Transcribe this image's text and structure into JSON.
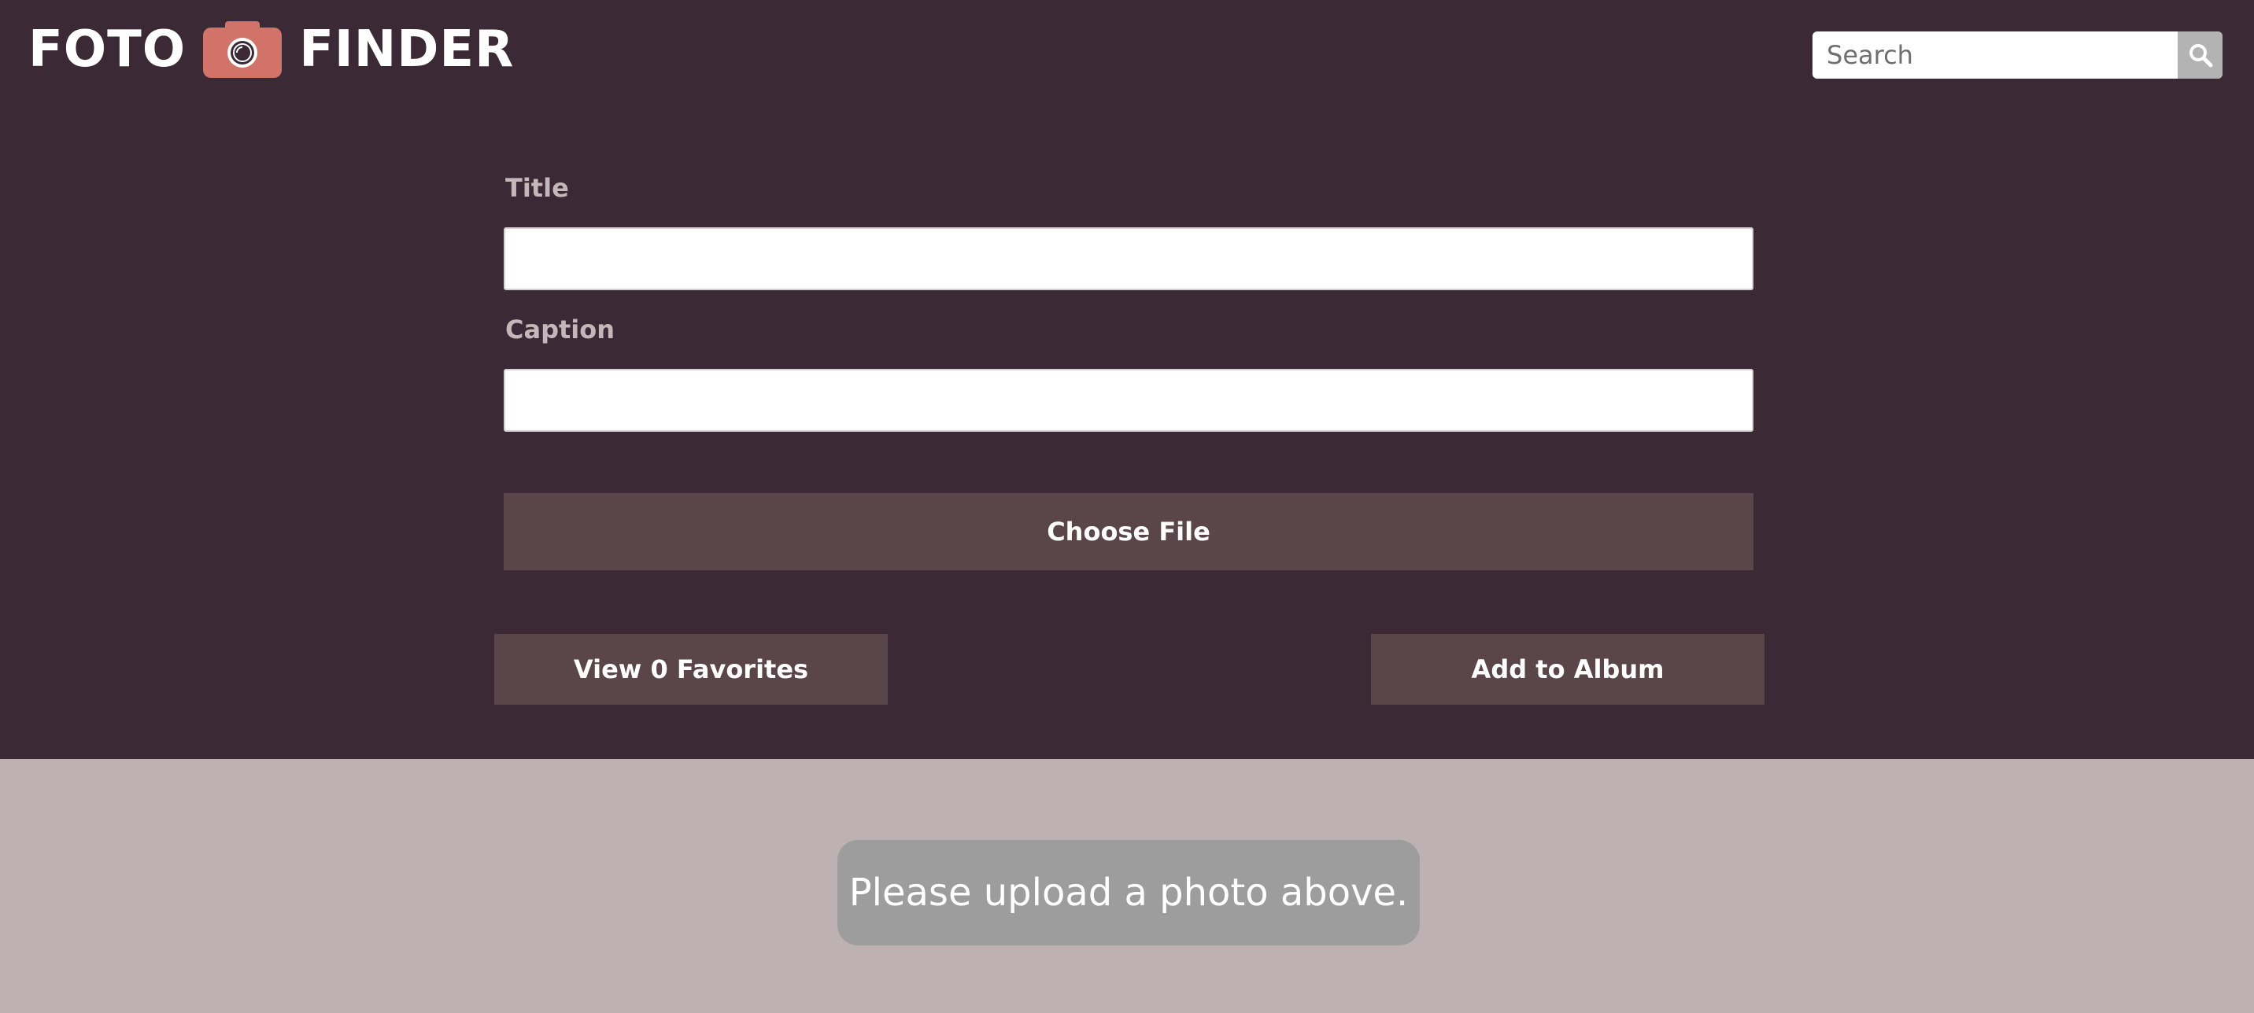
{
  "app": {
    "logo_left": "FOTO",
    "logo_right": "FINDER",
    "logo_icon": "camera-icon",
    "accent_color": "#d2736a"
  },
  "search": {
    "placeholder": "Search",
    "icon": "search-icon"
  },
  "form": {
    "title_label": "Title",
    "title_value": "",
    "caption_label": "Caption",
    "caption_value": "",
    "choose_file_label": "Choose File"
  },
  "actions": {
    "favorites_label": "View 0 Favorites",
    "add_album_label": "Add to Album"
  },
  "gallery": {
    "empty_message": "Please upload a photo above."
  },
  "colors": {
    "header_bg": "#3b2a35",
    "button_bg": "#59454a",
    "gallery_bg": "#bdb1b3",
    "notice_bg": "#9d9d9d"
  }
}
